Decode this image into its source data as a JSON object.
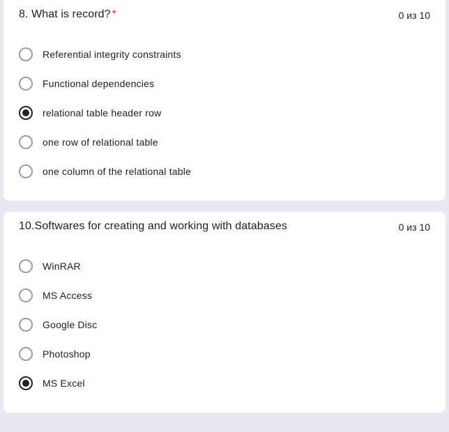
{
  "questions": [
    {
      "title": "8. What is record?",
      "required": true,
      "score": "0 из 10",
      "selectedIndex": 2,
      "options": [
        "Referential integrity constraints",
        "Functional dependencies",
        "relational table header row",
        "one row of relational table",
        "one column of the relational table"
      ]
    },
    {
      "title": "10.Softwares for creating and working with databases",
      "required": false,
      "score": "0 из 10",
      "selectedIndex": 4,
      "options": [
        "WinRAR",
        "MS Access",
        "Google Disc",
        "Photoshop",
        "MS Excel"
      ]
    }
  ]
}
